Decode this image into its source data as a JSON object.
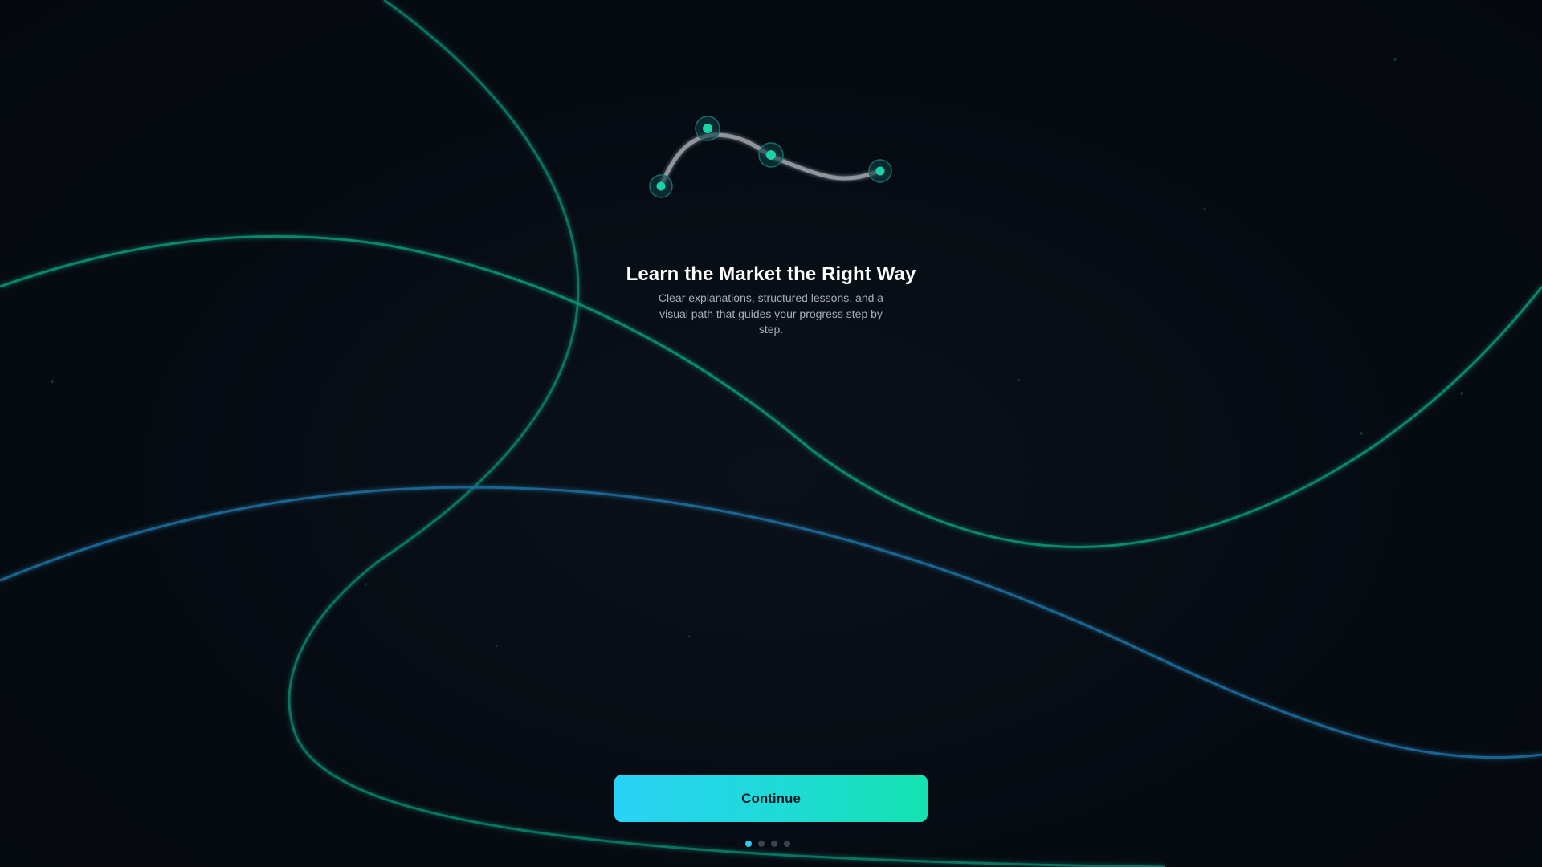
{
  "onboarding": {
    "title": "Learn the Market the Right Way",
    "subtitle": "Clear explanations, structured lessons, and a visual path that guides your progress step by step.",
    "continue_label": "Continue",
    "pager": {
      "total": 4,
      "active_index": 0
    }
  },
  "theme": {
    "background": "#060b12",
    "accent_green": "#10c9a0",
    "accent_blue": "#1e7fb8",
    "button_gradient_start": "#29d2f7",
    "button_gradient_end": "#13e2b0"
  },
  "icons": {
    "illustration": "learning-path-illustration"
  }
}
